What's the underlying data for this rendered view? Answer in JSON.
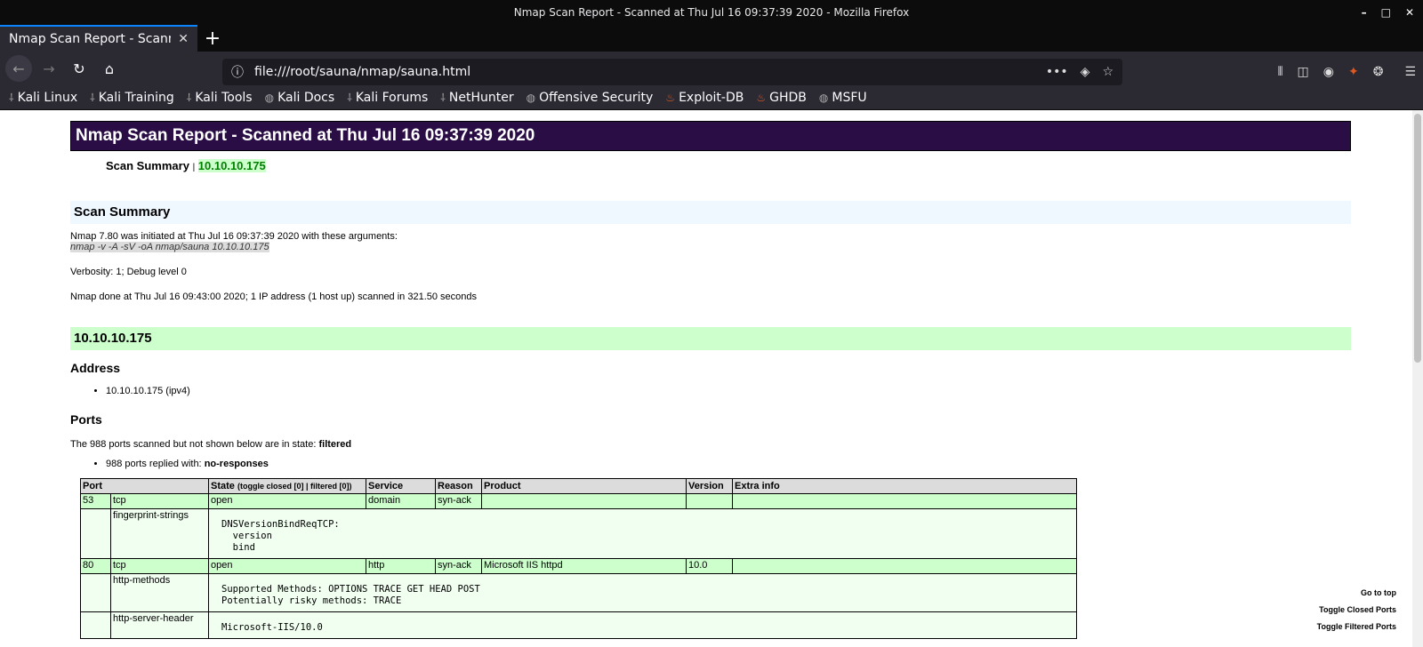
{
  "window": {
    "title": "Nmap Scan Report - Scanned at Thu Jul 16 09:37:39 2020 - Mozilla Firefox",
    "controls": [
      "–",
      "□",
      "✕"
    ]
  },
  "tab": {
    "label": "Nmap Scan Report - Scanned at",
    "close": "✕",
    "new": "+"
  },
  "nav": {
    "url": "file:///root/sauna/nmap/sauna.html",
    "more": "•••"
  },
  "bookmarks": [
    {
      "label": "Kali Linux",
      "icon": "kali-dragon-icon"
    },
    {
      "label": "Kali Training",
      "icon": "kali-dragon-icon"
    },
    {
      "label": "Kali Tools",
      "icon": "kali-dragon-icon"
    },
    {
      "label": "Kali Docs",
      "icon": "globe-icon"
    },
    {
      "label": "Kali Forums",
      "icon": "kali-dragon-icon"
    },
    {
      "label": "NetHunter",
      "icon": "kali-dragon-icon"
    },
    {
      "label": "Offensive Security",
      "icon": "globe-icon"
    },
    {
      "label": "Exploit-DB",
      "icon": "fire-icon"
    },
    {
      "label": "GHDB",
      "icon": "fire-icon"
    },
    {
      "label": "MSFU",
      "icon": "globe-icon"
    }
  ],
  "report": {
    "title": "Nmap Scan Report - Scanned at Thu Jul 16 09:37:39 2020",
    "toc_label": "Scan Summary",
    "toc_sep": "|",
    "toc_host": "10.10.10.175",
    "summary_heading": "Scan Summary",
    "initiated": "Nmap 7.80 was initiated at Thu Jul 16 09:37:39 2020 with these arguments:",
    "arguments": "nmap -v -A -sV -oA nmap/sauna 10.10.10.175",
    "verbosity": "Verbosity: 1; Debug level 0",
    "done": "Nmap done at Thu Jul 16 09:43:00 2020; 1 IP address (1 host up) scanned in 321.50 seconds",
    "host_heading": "10.10.10.175",
    "address_heading": "Address",
    "address": "10.10.10.175 (ipv4)",
    "ports_heading": "Ports",
    "filtered_text": "The 988 ports scanned but not shown below are in state:",
    "filtered_state": "filtered",
    "replied_text": "988 ports replied with:",
    "replied_reason": "no-responses",
    "table": {
      "headers": {
        "port": "Port",
        "state": "State",
        "state_toggle": "(toggle closed [0] | filtered [0])",
        "service": "Service",
        "reason": "Reason",
        "product": "Product",
        "version": "Version",
        "extra": "Extra info"
      },
      "rows": [
        {
          "port": "53",
          "proto": "tcp",
          "state": "open",
          "service": "domain",
          "reason": "syn-ack",
          "product": "",
          "version": "",
          "extra": "",
          "script_name": "fingerprint-strings",
          "script_output": "DNSVersionBindReqTCP:\n  version\n  bind"
        },
        {
          "port": "80",
          "proto": "tcp",
          "state": "open",
          "service": "http",
          "reason": "syn-ack",
          "product": "Microsoft IIS httpd",
          "version": "10.0",
          "extra": "",
          "script_name": "http-methods",
          "script_output": "Supported Methods: OPTIONS TRACE GET HEAD POST\nPotentially risky methods: TRACE"
        },
        {
          "script_name": "http-server-header",
          "script_output": "Microsoft-IIS/10.0"
        }
      ]
    },
    "side_links": [
      "Go to top",
      "Toggle Closed Ports",
      "Toggle Filtered Ports"
    ]
  }
}
